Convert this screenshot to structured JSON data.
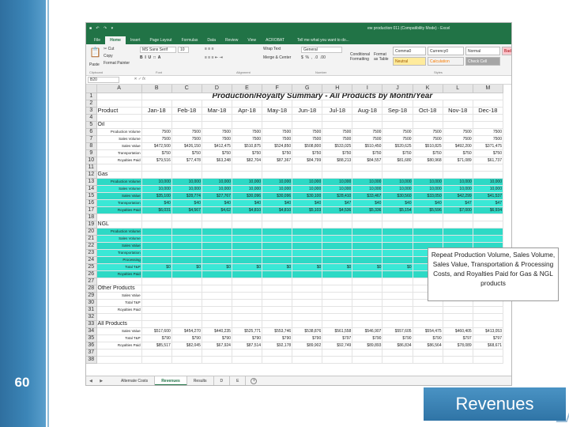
{
  "slide": {
    "number": "60",
    "title": "Revenues",
    "callout": "Repeat Production Volume, Sales Volume, Sales Value, Transportation & Processing Costs, and Royalties Paid for Gas & NGL products"
  },
  "excel": {
    "window_title": "ew  production 011 (Compatibility Mode) - Excel",
    "ribbon_tabs": [
      "File",
      "Home",
      "Insert",
      "Page Layout",
      "Formulas",
      "Data",
      "Review",
      "View",
      "ACROBAT"
    ],
    "tell_me": "Tell me what you want to do...",
    "ribbon": {
      "cut": "Cut",
      "copy": "Copy",
      "format_painter": "Format Painter",
      "paste": "Paste",
      "font_name": "MS Sans Serif",
      "font_size": "10",
      "wrap_text": "Wrap Text",
      "merge_center": "Merge & Center",
      "number_format": "General",
      "conditional_formatting": "Conditional Formatting",
      "format_as_table": "Format as Table",
      "styles": [
        "Comma0",
        "Currency0",
        "Normal",
        "Bad",
        "Neutral",
        "Calculation",
        "Check Cell"
      ],
      "groups": [
        "Clipboard",
        "Font",
        "Alignment",
        "Number",
        "Styles"
      ]
    },
    "name_box": "B20",
    "columns": [
      "A",
      "B",
      "C",
      "D",
      "E",
      "F",
      "G",
      "H",
      "I",
      "J",
      "K",
      "L",
      "M"
    ],
    "sheet_title": "Production/Royalty Summary - All Products by Month/Year",
    "product_label": "Product",
    "months": [
      "Jan-18",
      "Feb-18",
      "Mar-18",
      "Apr-18",
      "May-18",
      "Jun-18",
      "Jul-18",
      "Aug-18",
      "Sep-18",
      "Oct-18",
      "Nov-18",
      "Dec-18"
    ],
    "sections": {
      "oil": "Oil",
      "gas": "Gas",
      "ngl": "NGL",
      "other": "Other Products",
      "all": "All Products"
    },
    "oil_rows": [
      {
        "label": "Production Volume",
        "values": [
          "7500",
          "7500",
          "7500",
          "7500",
          "7500",
          "7500",
          "7500",
          "7500",
          "7500",
          "7500",
          "7500",
          "7500"
        ]
      },
      {
        "label": "Sales Volume",
        "values": [
          "7500",
          "7500",
          "7500",
          "7500",
          "7500",
          "7500",
          "7500",
          "7500",
          "7500",
          "7500",
          "7500",
          "7500"
        ]
      },
      {
        "label": "Sales Value",
        "values": [
          "$472,500",
          "$426,150",
          "$412,475",
          "$510,875",
          "$524,850",
          "$508,800",
          "$533,025",
          "$510,450",
          "$520,625",
          "$510,825",
          "$492,200",
          "$371,475"
        ]
      },
      {
        "label": "Transportation",
        "values": [
          "$750",
          "$750",
          "$750",
          "$750",
          "$750",
          "$750",
          "$750",
          "$750",
          "$750",
          "$750",
          "$750",
          "$750"
        ]
      },
      {
        "label": "Royalties Paid",
        "values": [
          "$79,516",
          "$77,478",
          "$63,248",
          "$82,704",
          "$87,367",
          "$84,799",
          "$88,213",
          "$84,557",
          "$81,680",
          "$80,968",
          "$71,089",
          "$61,737"
        ]
      }
    ],
    "gas_rows": [
      {
        "label": "Production Volume",
        "values": [
          "10,000",
          "10,000",
          "10,000",
          "10,000",
          "10,000",
          "10,000",
          "10,000",
          "10,000",
          "10,000",
          "10,000",
          "10,000",
          "10,000"
        ]
      },
      {
        "label": "Sales Volume",
        "values": [
          "10,000",
          "10,000",
          "10,000",
          "10,000",
          "10,000",
          "10,000",
          "10,000",
          "10,000",
          "10,000",
          "10,000",
          "10,000",
          "10,000"
        ]
      },
      {
        "label": "Sales Value",
        "values": [
          "$35,100",
          "$28,774",
          "$27,767",
          "$30,096",
          "$30,096",
          "$30,100",
          "$28,410",
          "$33,467",
          "$30,560",
          "$33,050",
          "$42,299",
          "$41,537"
        ]
      },
      {
        "label": "Transportation",
        "values": [
          "$40",
          "$40",
          "$40",
          "$40",
          "$40",
          "$40",
          "$47",
          "$40",
          "$40",
          "$40",
          "$47",
          "$47"
        ]
      },
      {
        "label": "Royalties Paid",
        "values": [
          "$6,031",
          "$4,567",
          "$4,62",
          "$4,810",
          "$4,810",
          "$5,103",
          "$4,536",
          "$5,336",
          "$5,154",
          "$5,596",
          "$7,000",
          "$6,934"
        ]
      }
    ],
    "ngl_rows": [
      {
        "label": "Production Volume",
        "values": [
          "",
          "",
          "",
          "",
          "",
          "",
          "",
          "",
          "",
          "",
          "",
          ""
        ]
      },
      {
        "label": "Sales Volume",
        "values": [
          "",
          "",
          "",
          "",
          "",
          "",
          "",
          "",
          "",
          "",
          "",
          ""
        ]
      },
      {
        "label": "Sales Value",
        "values": [
          "",
          "",
          "",
          "",
          "",
          "",
          "",
          "",
          "",
          "",
          "",
          ""
        ]
      },
      {
        "label": "Transportation",
        "values": [
          "",
          "",
          "",
          "",
          "",
          "",
          "",
          "",
          "",
          "",
          "",
          ""
        ]
      },
      {
        "label": "Processing",
        "values": [
          "",
          "",
          "",
          "",
          "",
          "",
          "",
          "",
          "",
          "",
          "",
          ""
        ]
      },
      {
        "label": "Total T&P",
        "values": [
          "$0",
          "$0",
          "$0",
          "$0",
          "$0",
          "$0",
          "$0",
          "$0",
          "$0",
          "",
          "",
          ""
        ]
      },
      {
        "label": "Royalties Paid",
        "values": [
          "",
          "",
          "",
          "",
          "",
          "",
          "",
          "",
          "",
          "",
          "",
          ""
        ]
      }
    ],
    "other_rows": [
      {
        "label": "Sales Value",
        "values": [
          "",
          "",
          "",
          "",
          "",
          "",
          "",
          "",
          "",
          "",
          "",
          ""
        ]
      },
      {
        "label": "Total T&P",
        "values": [
          "",
          "",
          "",
          "",
          "",
          "",
          "",
          "",
          "",
          "",
          "",
          ""
        ]
      },
      {
        "label": "Royalties Paid",
        "values": [
          "",
          "",
          "",
          "",
          "",
          "",
          "",
          "",
          "",
          "",
          "",
          ""
        ]
      }
    ],
    "all_rows": [
      {
        "label": "Sales Value",
        "values": [
          "$517,600",
          "$454,270",
          "$440,235",
          "$525,771",
          "$553,746",
          "$538,876",
          "$561,558",
          "$546,907",
          "$557,605",
          "$554,475",
          "$460,405",
          "$413,053"
        ]
      },
      {
        "label": "Total T&P",
        "values": [
          "$790",
          "$790",
          "$790",
          "$790",
          "$790",
          "$790",
          "$797",
          "$790",
          "$790",
          "$790",
          "$797",
          "$797"
        ]
      },
      {
        "label": "Royalties Paid",
        "values": [
          "$85,517",
          "$82,045",
          "$67,924",
          "$87,514",
          "$92,178",
          "$89,902",
          "$92,749",
          "$89,893",
          "$86,834",
          "$86,564",
          "$78,089",
          "$68,671"
        ]
      }
    ],
    "sheet_tabs": [
      "Alternate Costs",
      "Revenues",
      "Results",
      "D",
      "E"
    ],
    "active_sheet": "Revenues"
  }
}
